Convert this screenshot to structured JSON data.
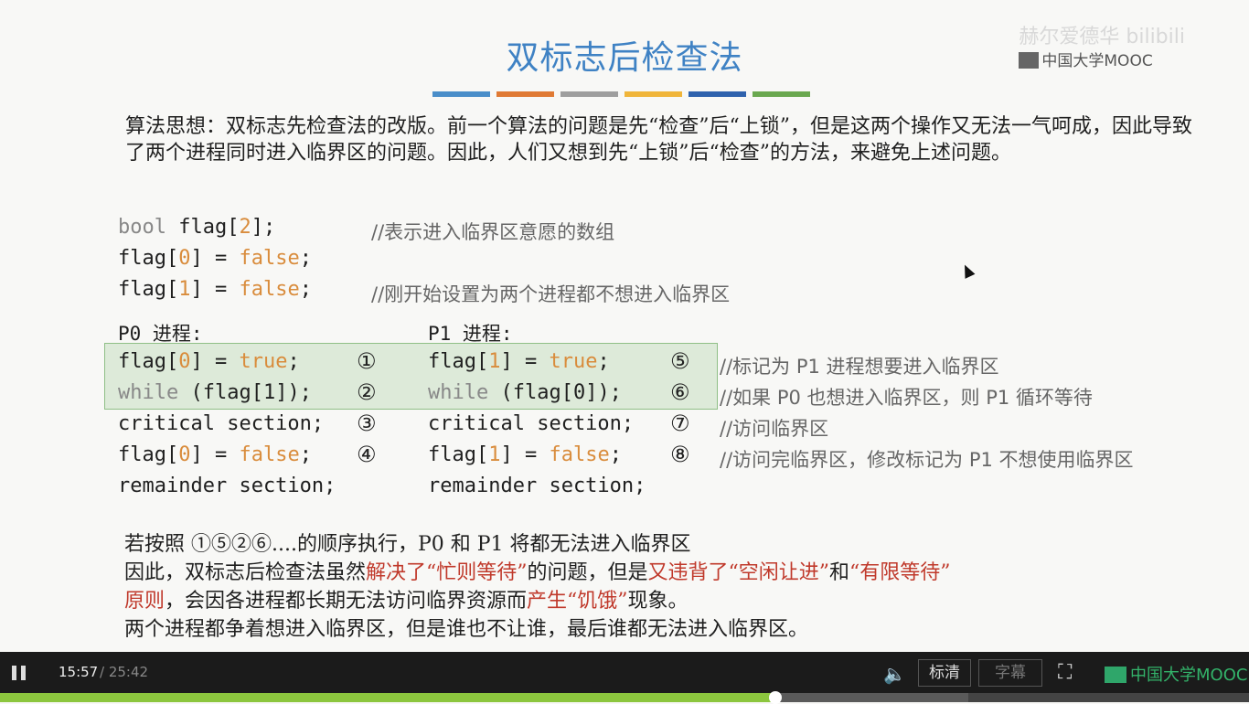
{
  "slide": {
    "title": "双标志后检查法",
    "title_bar_colors": [
      "#4a8ec9",
      "#e07a34",
      "#9e9e9e",
      "#f0b53a",
      "#2f62ad",
      "#6aa84f"
    ],
    "watermark": "赫尔爱德华 bilibili",
    "watermark_mooc": "中国大学MOOC",
    "intro": "算法思想：双标志先检查法的改版。前一个算法的问题是先“检查”后“上锁”，但是这两个操作又无法一气呵成，因此导致了两个进程同时进入临界区的问题。因此，人们又想到先“上锁”后“检查”的方法，来避免上述问题。",
    "code_top": [
      {
        "pre": "bool",
        "mid": " flag[",
        "num": "2",
        "post": "];",
        "comment": "//表示进入临界区意愿的数组"
      },
      {
        "pre": "",
        "mid": "flag[",
        "num": "0",
        "post": "] = ",
        "val": "false",
        "end": ";",
        "comment": ""
      },
      {
        "pre": "",
        "mid": "flag[",
        "num": "1",
        "post": "] = ",
        "val": "false",
        "end": ";",
        "comment": "//刚开始设置为两个进程都不想进入临界区"
      }
    ],
    "p0_header": "P0 进程:",
    "p1_header": "P1 进程:",
    "rows": [
      {
        "p0": "flag[0] = true;",
        "c0": "①",
        "p1": "flag[1] = true;",
        "c1": "⑤",
        "comment": "//标记为 P1 进程想要进入临界区"
      },
      {
        "p0": "while (flag[1]);",
        "c0": "②",
        "p1": "while (flag[0]);",
        "c1": "⑥",
        "comment": "//如果 P0 也想进入临界区，则 P1 循环等待"
      },
      {
        "p0": "critical section;",
        "c0": "③",
        "p1": "critical section;",
        "c1": "⑦",
        "comment": "//访问临界区"
      },
      {
        "p0": "flag[0] = false;",
        "c0": "④",
        "p1": "flag[1] = false;",
        "c1": "⑧",
        "comment": "//访问完临界区，修改标记为 P1 不想使用临界区"
      },
      {
        "p0": "remainder section;",
        "c0": "",
        "p1": "remainder section;",
        "c1": "",
        "comment": ""
      }
    ],
    "conclusion": {
      "line1": "若按照 ①⑤②⑥....的顺序执行，P0 和 P1 将都无法进入临界区",
      "line2_a": "因此，双标志后检查法虽然",
      "line2_b": "解决了“忙则等待”",
      "line2_c": "的问题，但是",
      "line2_d": "又违背了“空闲让进”",
      "line2_e": "和",
      "line2_f": "“有限等待”",
      "line3_a": "原则",
      "line3_b": "，会因各进程都长期无法访问临界资源而",
      "line3_c": "产生“饥饿”",
      "line3_d": "现象。",
      "line4": "两个进程都争着想进入临界区，但是谁也不让谁，最后谁都无法进入临界区。"
    }
  },
  "player": {
    "current_time": "15:57",
    "total_time": "/ 25:42",
    "quality_label": "标清",
    "subtitle_label": "字幕",
    "brand": "中国大学MOOC",
    "progress": 0.621,
    "buffered": 0.775
  }
}
